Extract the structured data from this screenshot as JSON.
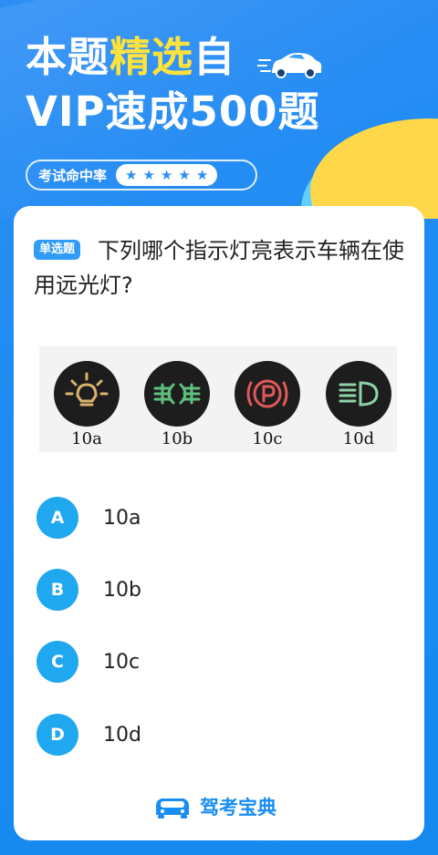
{
  "header": {
    "title_part1": "本题",
    "title_highlight": "精选",
    "title_part2": "自",
    "title_line2": "VIP速成500题",
    "hit_rate_label": "考试命中率",
    "stars": 5
  },
  "question": {
    "type_badge": "单选题",
    "text": "下列哪个指示灯亮表示车辆在使用远光灯?",
    "image": {
      "icon_labels": [
        "10a",
        "10b",
        "10c",
        "10d"
      ]
    }
  },
  "options": [
    {
      "letter": "A",
      "text": "10a"
    },
    {
      "letter": "B",
      "text": "10b"
    },
    {
      "letter": "C",
      "text": "10c"
    },
    {
      "letter": "D",
      "text": "10d"
    }
  ],
  "footer": {
    "brand_name": "驾考宝典"
  },
  "colors": {
    "primary": "#2f8ef5",
    "highlight": "#ffe23c",
    "option_circle": "#1fa7ef"
  }
}
